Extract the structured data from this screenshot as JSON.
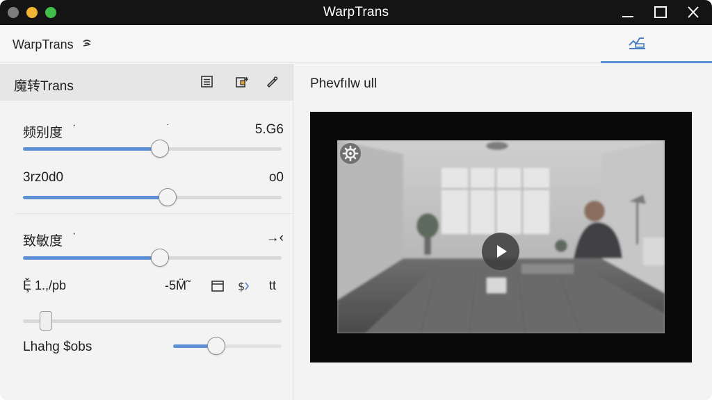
{
  "window": {
    "title": "WarpTrans"
  },
  "header": {
    "app_name": "WarpTrans",
    "tab_icon": "chart-line-icon"
  },
  "left_panel": {
    "title": "魔转Trans",
    "controls": [
      {
        "label": "频别度",
        "label_marker": "·",
        "mid_marker": "ˑ",
        "value": "5.G6",
        "level": 0.53
      },
      {
        "label": "3rz0d0",
        "value": "o0",
        "level": 0.56
      },
      {
        "label": "致敏度",
        "label_marker": "·",
        "value": "→‹",
        "level": 0.53
      }
    ],
    "toolbar_row": {
      "left_text": "Ȩ̌ 1.,/pb",
      "middle_text": "-5M̈̃",
      "right_text": "tt"
    },
    "range_slider": {
      "level": 0.09
    },
    "lighting": {
      "label": "Lhahg $obs",
      "level": 0.4
    }
  },
  "preview": {
    "title": "Phevfılw ull"
  },
  "colors": {
    "accent": "#5b8fd6",
    "titlebar": "#141414",
    "panel_header": "#e6e6e6"
  }
}
